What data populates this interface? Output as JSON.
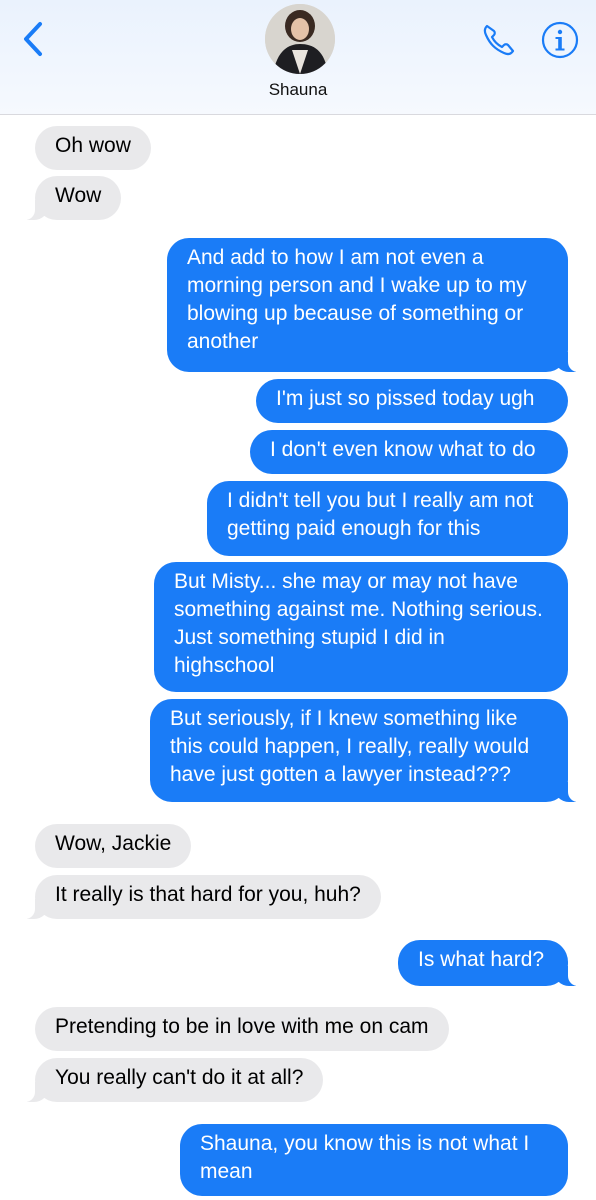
{
  "header": {
    "contact_name": "Shauna",
    "back_icon": "chevron-left-icon",
    "call_icon": "phone-icon",
    "info_icon": "info-icon",
    "accent_color": "#1a7cf7"
  },
  "messages": [
    {
      "from": "contact",
      "text": "Oh wow"
    },
    {
      "from": "contact",
      "text": "Wow"
    },
    {
      "from": "me",
      "text": "And add to how I am not even a morning person and I wake up to my blowing up because of something or another"
    },
    {
      "from": "me",
      "text": "I'm just so pissed today ugh"
    },
    {
      "from": "me",
      "text": "I don't even know what to do"
    },
    {
      "from": "me",
      "text": "I didn't tell you but I really am not getting paid enough for this"
    },
    {
      "from": "me",
      "text": "But Misty... she may or may not have something against me. Nothing serious. Just something stupid I did in highschool"
    },
    {
      "from": "me",
      "text": "But seriously, if I knew something like this could happen, I really, really would have just gotten a lawyer instead???"
    },
    {
      "from": "contact",
      "text": "Wow, Jackie"
    },
    {
      "from": "contact",
      "text": "It really is that hard for you, huh?"
    },
    {
      "from": "me",
      "text": "Is what hard?"
    },
    {
      "from": "contact",
      "text": "Pretending to be in love with me on cam"
    },
    {
      "from": "contact",
      "text": "You really can't do it at all?"
    },
    {
      "from": "me",
      "text": "Shauna, you know this is not what I mean"
    }
  ]
}
